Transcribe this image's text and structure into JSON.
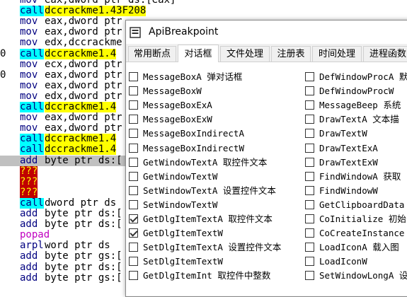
{
  "disasm": [
    {
      "mn": "mov",
      "op": "eax,dword ptr ds:[eax]",
      "style": "plain"
    },
    {
      "mn": "call",
      "op": "dccrackme1.43F208",
      "style": "call-yellow"
    },
    {
      "mn": "mov",
      "op": "eax,dword ptr",
      "style": "plain"
    },
    {
      "mn": "mov",
      "op": "eax,dword ptr",
      "style": "plain"
    },
    {
      "mn": "mov",
      "op": "edx,dccrackme",
      "style": "plain"
    },
    {
      "mn": "call",
      "op": "dccrackme1.4",
      "style": "call-yellow",
      "gutter": "0"
    },
    {
      "mn": "mov",
      "op": "ecx,dword ptr",
      "style": "plain"
    },
    {
      "mn": "mov",
      "op": "eax,dword ptr",
      "style": "plain",
      "gutter": "0"
    },
    {
      "mn": "mov",
      "op": "eax,dword ptr",
      "style": "plain"
    },
    {
      "mn": "mov",
      "op": "edx,dword ptr",
      "style": "plain"
    },
    {
      "mn": "call",
      "op": "dccrackme1.4",
      "style": "call-yellow"
    },
    {
      "mn": "mov",
      "op": "eax,dword ptr",
      "style": "plain"
    },
    {
      "mn": "mov",
      "op": "eax,dword ptr",
      "style": "plain"
    },
    {
      "mn": "call",
      "op": "dccrackme1.4",
      "style": "call-yellow"
    },
    {
      "mn": "call",
      "op": "dccrackme1.4",
      "style": "call-yellow"
    },
    {
      "mn": "add",
      "op": "byte ptr ds:[",
      "style": "selected"
    },
    {
      "mn": "???",
      "op": "",
      "style": "red"
    },
    {
      "mn": "???",
      "op": "",
      "style": "red"
    },
    {
      "mn": "???",
      "op": "",
      "style": "red"
    },
    {
      "mn": "call",
      "op": "dword ptr ds",
      "style": "call-cyan-only"
    },
    {
      "mn": "add",
      "op": "byte ptr ds:[",
      "style": "plain"
    },
    {
      "mn": "add",
      "op": "byte ptr ds:[",
      "style": "plain"
    },
    {
      "mn": "popad",
      "op": "",
      "style": "mag"
    },
    {
      "mn": "arpl",
      "op": "word ptr ds",
      "style": "plain"
    },
    {
      "mn": "add",
      "op": "byte ptr gs:[",
      "style": "plain"
    },
    {
      "mn": "add",
      "op": "byte ptr ds:[",
      "style": "plain"
    },
    {
      "mn": "add",
      "op": "byte ptr gs:[",
      "style": "plain"
    }
  ],
  "window": {
    "title": "ApiBreakpoint"
  },
  "tabs": [
    {
      "label": "常用断点",
      "active": false
    },
    {
      "label": "对话框",
      "active": true
    },
    {
      "label": "文件处理",
      "active": false
    },
    {
      "label": "注册表",
      "active": false
    },
    {
      "label": "时间处理",
      "active": false
    },
    {
      "label": "进程函数",
      "active": false
    }
  ],
  "left_items": [
    {
      "api": "MessageBoxA",
      "zh": "弹对话框",
      "checked": false
    },
    {
      "api": "MessageBoxW",
      "zh": "",
      "checked": false
    },
    {
      "api": "MessageBoxExA",
      "zh": "",
      "checked": false
    },
    {
      "api": "MessageBoxExW",
      "zh": "",
      "checked": false
    },
    {
      "api": "MessageBoxIndirectA",
      "zh": "",
      "checked": false
    },
    {
      "api": "MessageBoxIndirectW",
      "zh": "",
      "checked": false
    },
    {
      "api": "GetWindowTextA",
      "zh": "取控件文本",
      "checked": false
    },
    {
      "api": "GetWindowTextW",
      "zh": "",
      "checked": false
    },
    {
      "api": "SetWindowTextA",
      "zh": "设置控件文本",
      "checked": false
    },
    {
      "api": "SetWindowTextW",
      "zh": "",
      "checked": false
    },
    {
      "api": "GetDlgItemTextA",
      "zh": "取控件文本",
      "checked": true
    },
    {
      "api": "GetDlgItemTextW",
      "zh": "",
      "checked": true
    },
    {
      "api": "SetDlgItemTextA",
      "zh": "设置控件文本",
      "checked": false
    },
    {
      "api": "SetDlgItemTextW",
      "zh": "",
      "checked": false
    },
    {
      "api": "GetDlgItemInt",
      "zh": "取控件中整数",
      "checked": false
    }
  ],
  "right_items": [
    {
      "api": "DefWindowProcA",
      "zh": "默",
      "checked": false
    },
    {
      "api": "DefWindowProcW",
      "zh": "",
      "checked": false
    },
    {
      "api": "MessageBeep",
      "zh": "系统",
      "checked": false
    },
    {
      "api": "DrawTextA",
      "zh": "文本描",
      "checked": false
    },
    {
      "api": "DrawTextW",
      "zh": "",
      "checked": false
    },
    {
      "api": "DrawTextExA",
      "zh": "",
      "checked": false
    },
    {
      "api": "DrawTextExW",
      "zh": "",
      "checked": false
    },
    {
      "api": "FindWindowA",
      "zh": "获取",
      "checked": false
    },
    {
      "api": "FindWindowW",
      "zh": "",
      "checked": false
    },
    {
      "api": "GetClipboardData",
      "zh": "",
      "checked": false
    },
    {
      "api": "CoInitialize",
      "zh": "初始",
      "checked": false
    },
    {
      "api": "CoCreateInstance",
      "zh": "",
      "checked": false
    },
    {
      "api": "LoadIconA",
      "zh": "载入图",
      "checked": false
    },
    {
      "api": "LoadIconW",
      "zh": "",
      "checked": false
    },
    {
      "api": "SetWindowLongA",
      "zh": "设",
      "checked": false
    }
  ],
  "colors": {
    "call_bg": "#00ffff",
    "target_bg": "#ffff00",
    "red_bg": "#c00000",
    "mnemonic": "#000080"
  }
}
